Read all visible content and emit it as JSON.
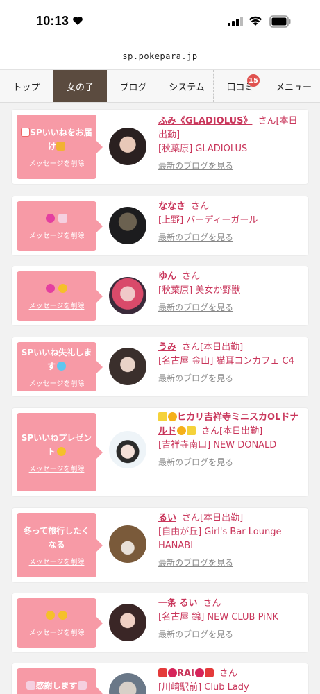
{
  "status": {
    "time": "10:13"
  },
  "url": "sp.pokepara.jp",
  "nav": {
    "tabs": [
      {
        "label": "トップ",
        "active": false
      },
      {
        "label": "女の子",
        "active": true
      },
      {
        "label": "ブログ",
        "active": false
      },
      {
        "label": "システム",
        "active": false
      },
      {
        "label": "口コミ",
        "active": false,
        "badge": "15"
      },
      {
        "label": "メニュー",
        "active": false
      }
    ]
  },
  "delete_label": "メッセージを削除",
  "blog_label": "最新のブログを見る",
  "san": "さん",
  "cards": [
    {
      "msg": "SPいいねをお届け",
      "name": "ふみ《GLADIOLUS》",
      "status": "[本日出勤]",
      "shop": "[秋葉原] GLADIOLUS"
    },
    {
      "msg": "",
      "name": "ななさ",
      "status": "",
      "shop": "[上野] バーディーガール"
    },
    {
      "msg": "",
      "name": "ゆん",
      "status": "",
      "shop": "[秋葉原] 美女か野獣"
    },
    {
      "msg": "SPいいね失礼します",
      "name": "うみ",
      "status": "[本日出勤]",
      "shop": "[名古屋 金山] 猫耳コンカフェ C4"
    },
    {
      "msg": "SPいいねプレゼント",
      "name": "ヒカリ吉祥寺ミニスカOLドナルド",
      "status": "[本日出勤]",
      "shop": "[吉祥寺南口] NEW DONALD"
    },
    {
      "msg": "冬って旅行したくなる",
      "name": "るい",
      "status": "[本日出勤]",
      "shop": "[自由が丘] Girl's Bar Lounge HANABI"
    },
    {
      "msg": "",
      "name": "一条 るい",
      "status": "",
      "shop": "[名古屋 錦] NEW CLUB PiNK"
    },
    {
      "msg": "感謝します",
      "name": "RAI",
      "status": "",
      "shop": "[川崎駅前] Club Lady"
    }
  ]
}
